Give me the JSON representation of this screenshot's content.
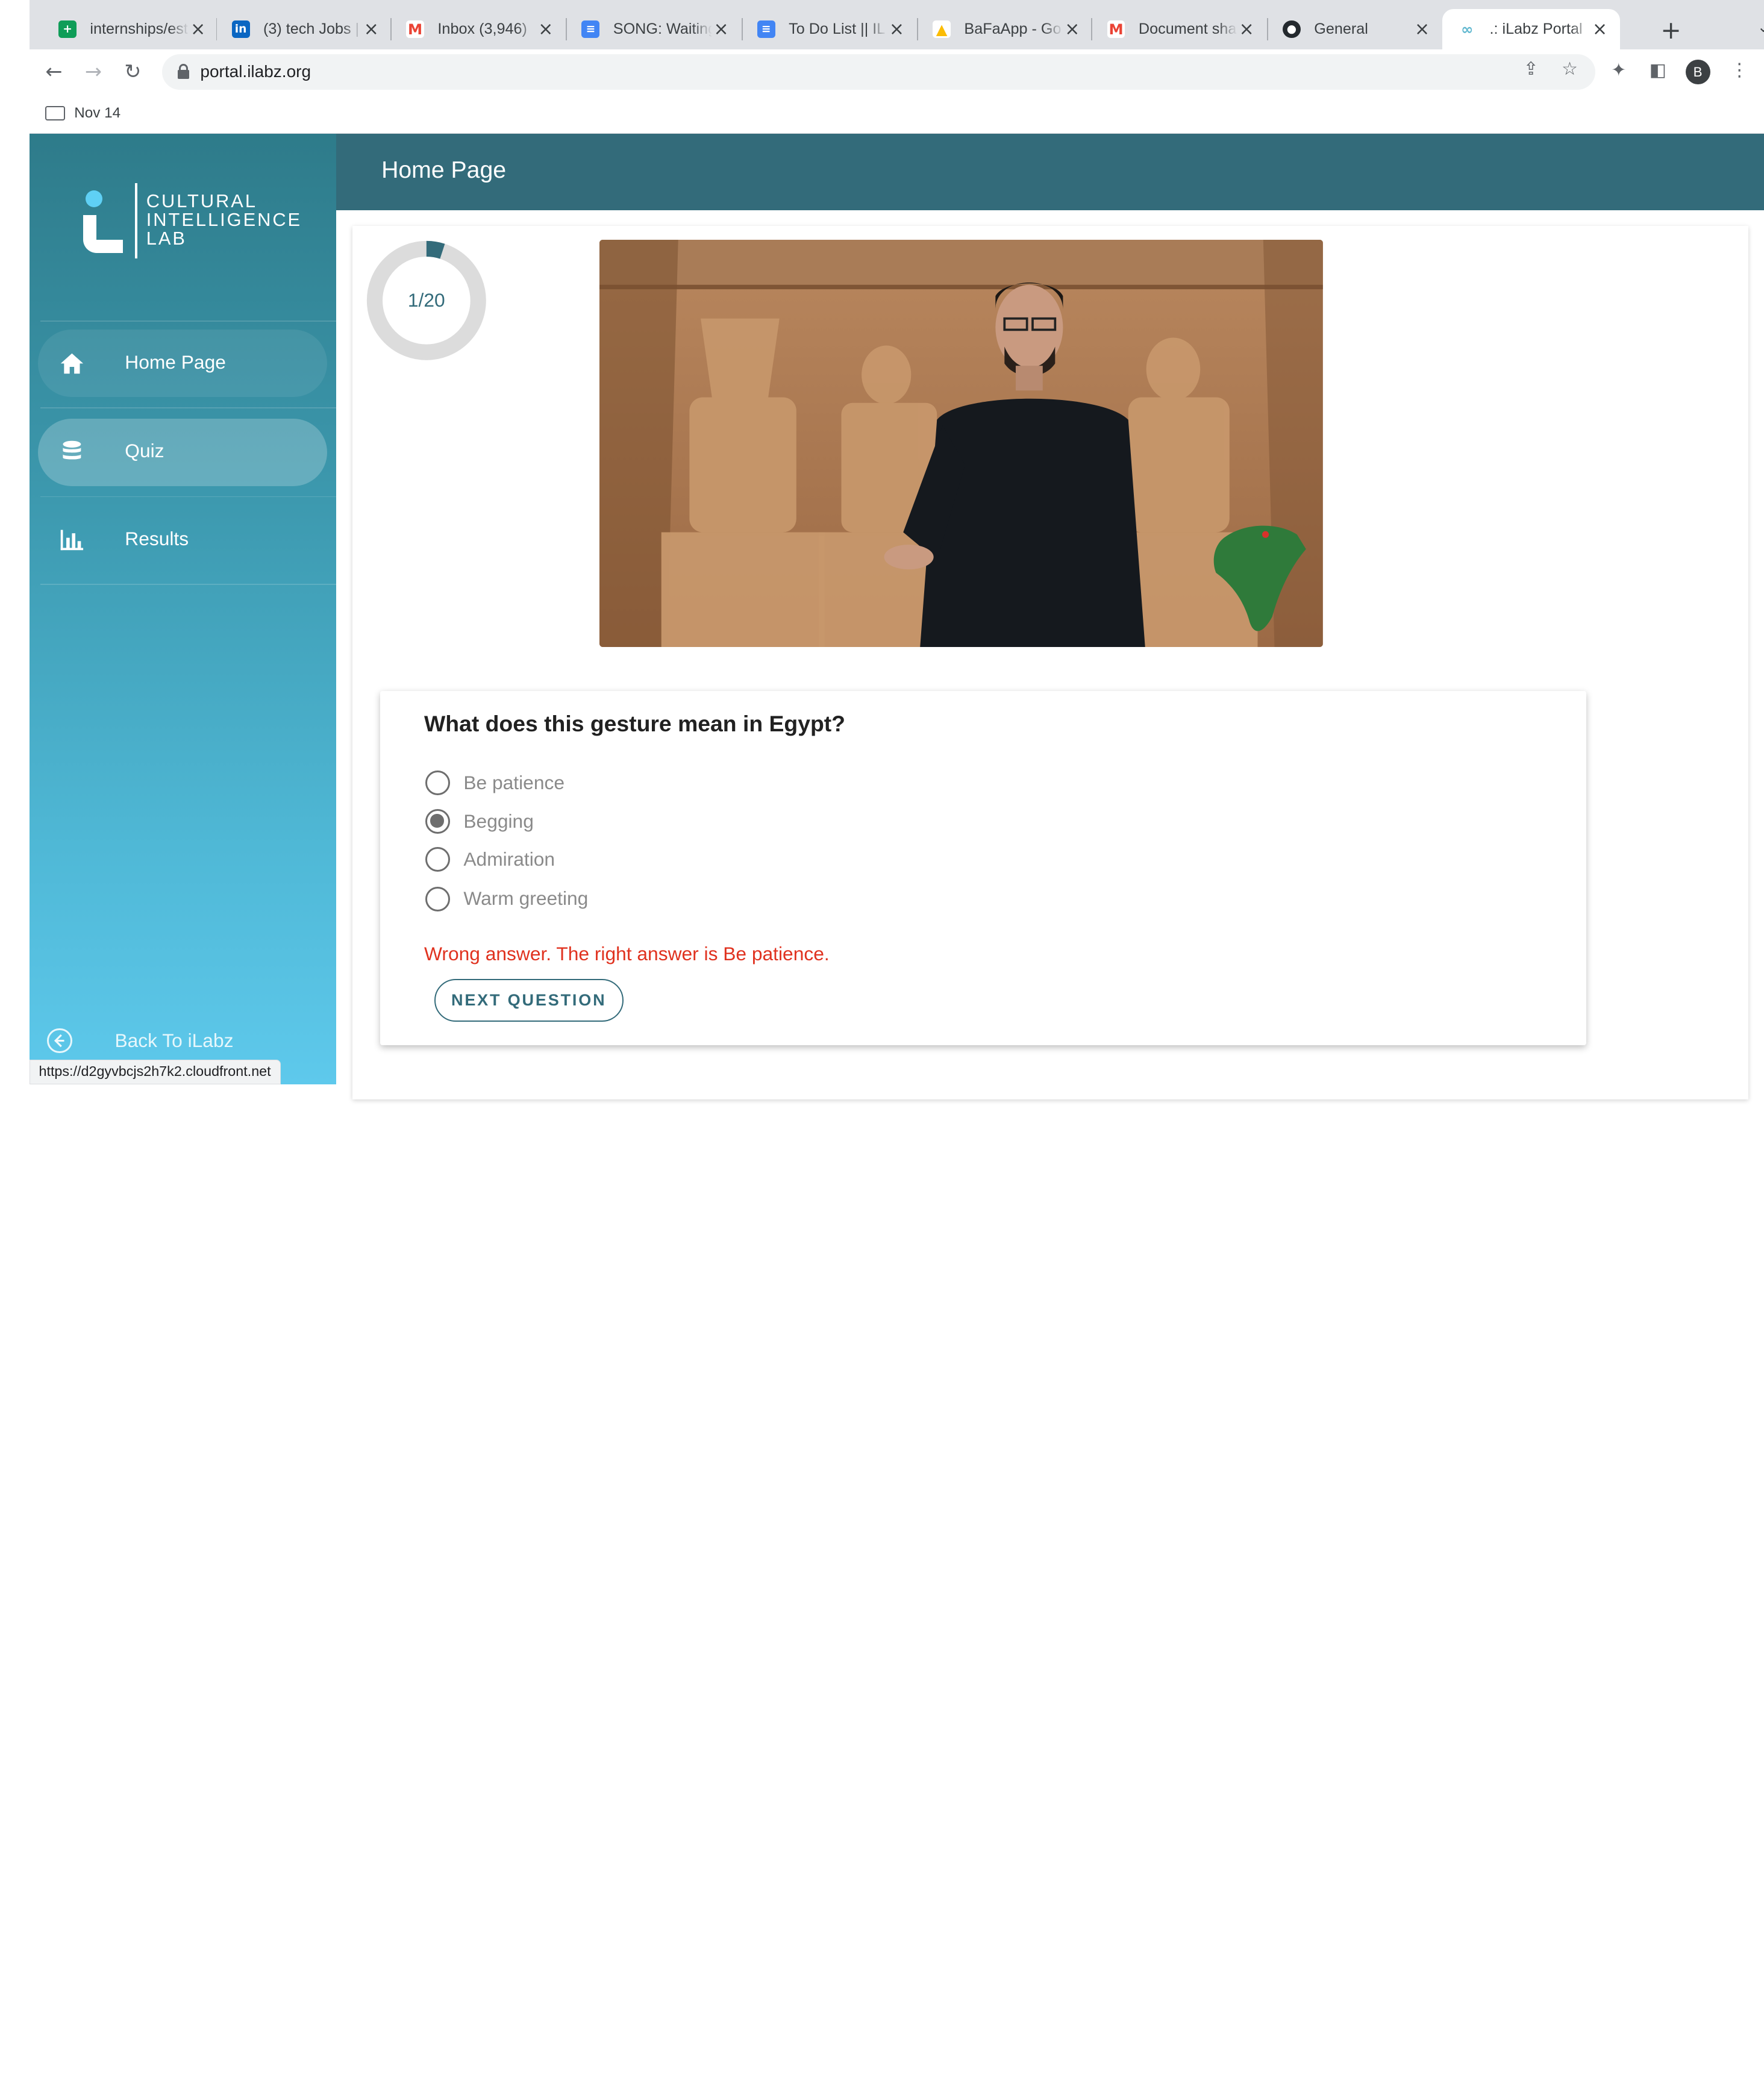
{
  "browser": {
    "tabs": [
      {
        "title": "internships/est",
        "icon": "google-sheets-icon",
        "color": "#0f9d58",
        "glyph": "+"
      },
      {
        "title": "(3) tech Jobs |",
        "icon": "linkedin-icon",
        "color": "#0a66c2",
        "glyph": "in"
      },
      {
        "title": "Inbox (3,946)",
        "icon": "gmail-icon",
        "color": "#ea4335",
        "glyph": "M"
      },
      {
        "title": "SONG: Waiting",
        "icon": "google-docs-icon",
        "color": "#4285f4",
        "glyph": "≡"
      },
      {
        "title": "To Do List || IL",
        "icon": "google-docs-icon",
        "color": "#4285f4",
        "glyph": "≡"
      },
      {
        "title": "BaFaApp - Go",
        "icon": "google-drive-icon",
        "color": "#fbbc04",
        "glyph": "▲"
      },
      {
        "title": "Document sha",
        "icon": "gmail-icon",
        "color": "#ea4335",
        "glyph": "M"
      },
      {
        "title": "General",
        "icon": "github-icon",
        "color": "#24292e",
        "glyph": "●"
      },
      {
        "title": ".: iLabz Portal",
        "icon": "ilabz-icon",
        "color": "#5fb7cf",
        "glyph": "∞"
      }
    ],
    "active_tab_index": 8,
    "url": "portal.ilabz.org",
    "bookmark": "Nov 14",
    "profile_initial": "B",
    "status_url": "https://d2gyvbcjs2h7k2.cloudfront.net"
  },
  "logo": {
    "line1": "CULTURAL",
    "line2": "INTELLIGENCE",
    "line3": "LAB"
  },
  "sidebar": {
    "items": [
      {
        "label": "Home Page",
        "icon": "home-icon"
      },
      {
        "label": "Quiz",
        "icon": "database-icon"
      },
      {
        "label": "Results",
        "icon": "bar-chart-icon"
      }
    ],
    "active_index": 1,
    "back_label": "Back To iLabz"
  },
  "header": {
    "title": "Home Page"
  },
  "quiz": {
    "progress_label": "1/20",
    "progress_fraction": 0.05,
    "progress_color": "#336b7a",
    "question": "What does this gesture mean in Egypt?",
    "options": [
      "Be patience",
      "Begging",
      "Admiration",
      "Warm greeting"
    ],
    "selected_index": 1,
    "feedback": "Wrong answer. The right answer is Be patience.",
    "feedback_color": "#e0321f",
    "next_label": "NEXT QUESTION"
  }
}
